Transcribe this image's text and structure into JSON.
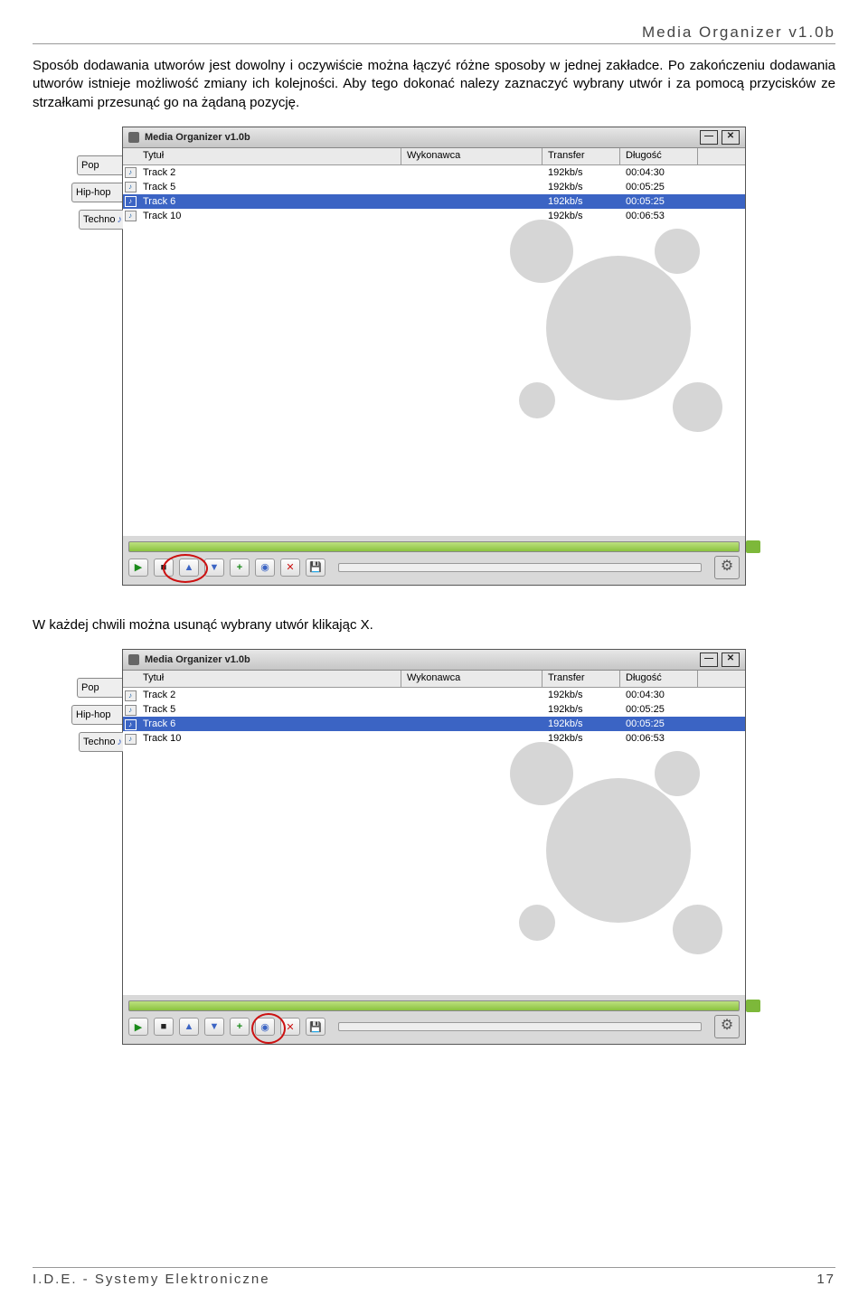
{
  "header": "Media Organizer v1.0b",
  "para1": "Sposób dodawania utworów jest dowolny i oczywiście można łączyć różne sposoby w jednej zakładce. Po zakończeniu dodawania utworów istnieje możliwość zmiany ich kolejności. Aby tego dokonać nalezy zaznaczyć wybrany utwór i za pomocą przycisków ze strzałkami przesunąć go na żądaną pozycję.",
  "para2": "W każdej chwili można usunąć wybrany utwór klikając X.",
  "tabs": [
    "Pop",
    "Hip-hop",
    "Techno"
  ],
  "win_title": "Media Organizer v1.0b",
  "columns": {
    "c2": "Tytuł",
    "c3": "Wykonawca",
    "c4": "Transfer",
    "c5": "Długość"
  },
  "rows": [
    {
      "t": "Track 2",
      "tr": "192kb/s",
      "d": "00:04:30",
      "sel": false
    },
    {
      "t": "Track 5",
      "tr": "192kb/s",
      "d": "00:05:25",
      "sel": false
    },
    {
      "t": "Track 6",
      "tr": "192kb/s",
      "d": "00:05:25",
      "sel": true
    },
    {
      "t": "Track 10",
      "tr": "192kb/s",
      "d": "00:06:53",
      "sel": false
    }
  ],
  "footer_left": "I.D.E. - Systemy Elektroniczne",
  "footer_right": "17"
}
